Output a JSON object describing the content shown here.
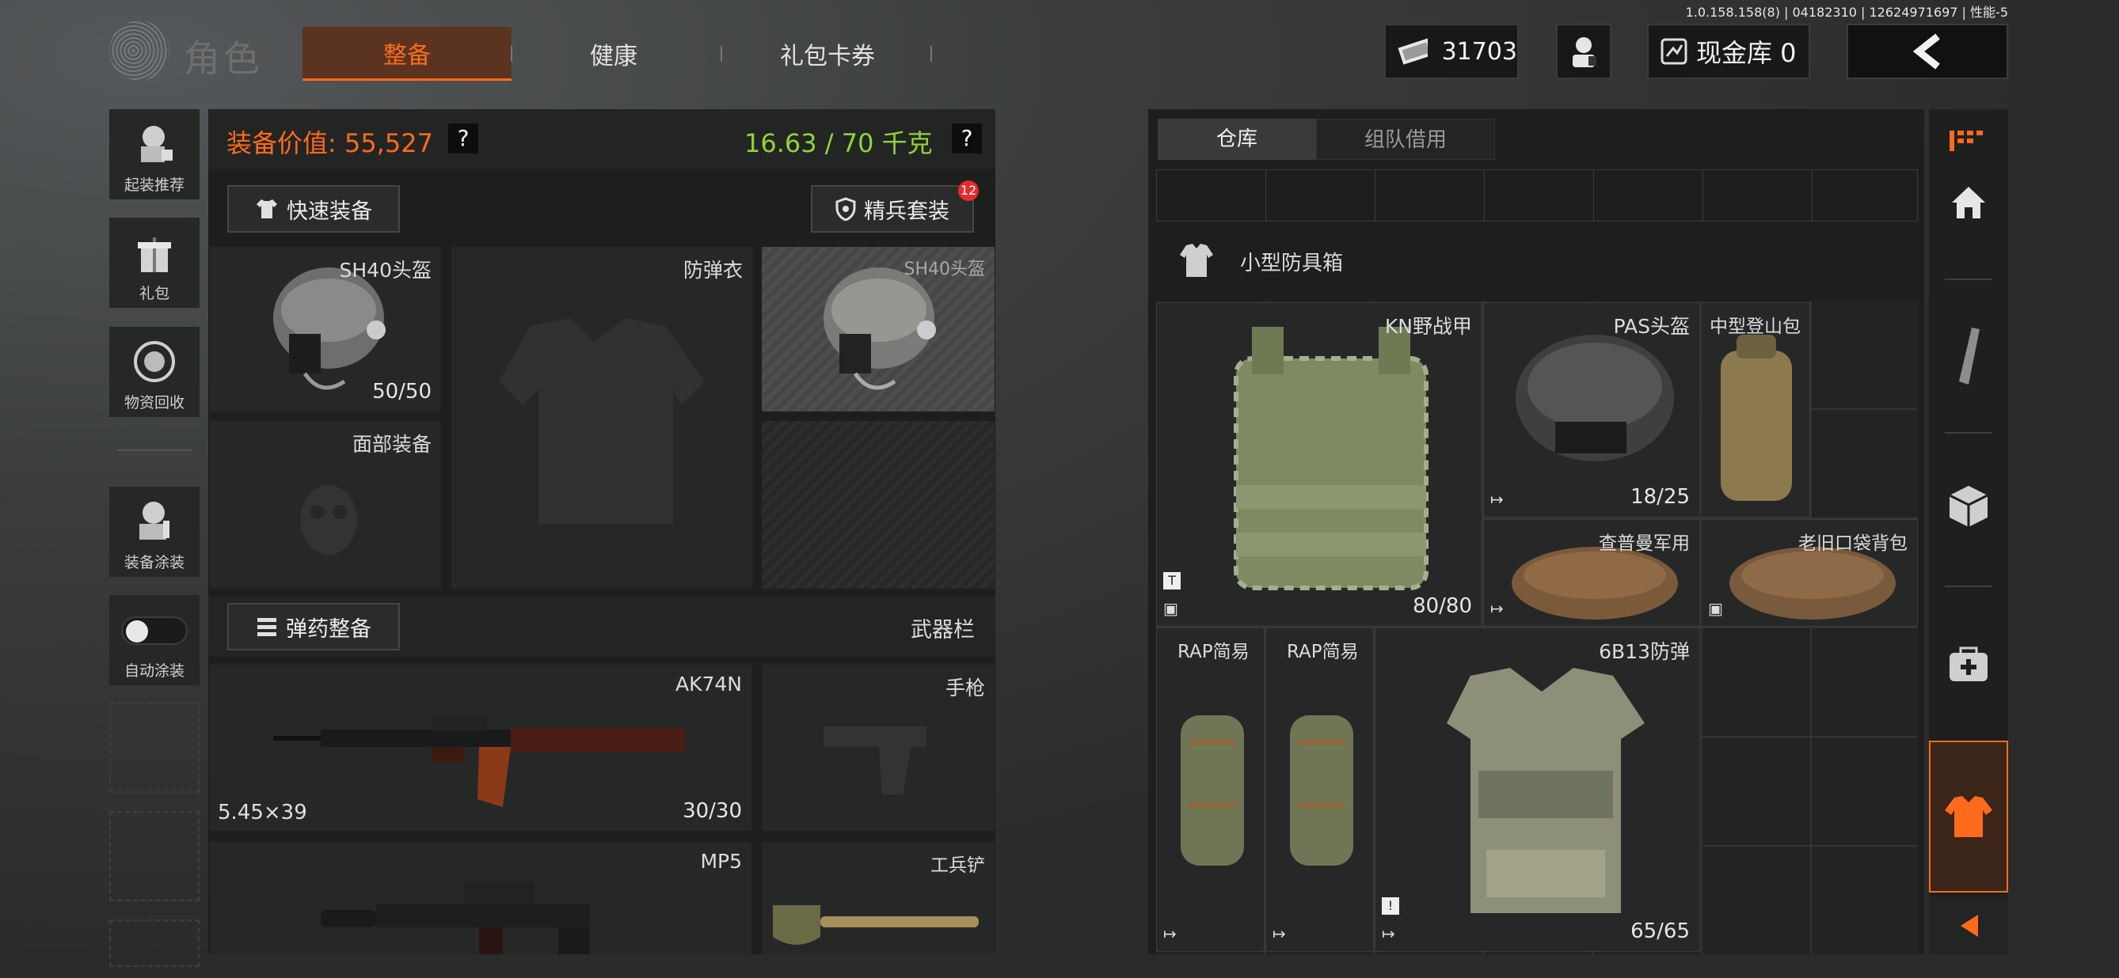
{
  "version": "1.0.158.158(8) | 04182310 | 12624971697 | 性能-5",
  "header": {
    "role": "角色",
    "tabs": [
      "整备",
      "健康",
      "礼包卡券"
    ],
    "money": "31703",
    "cash_store": "现金库 0"
  },
  "left": {
    "value_label": "装备价值: 55,527",
    "weight": "16.63 / 70 千克",
    "help": "?",
    "quick_equip": "快速装备",
    "elite_set": "精兵套装",
    "elite_badge": "12",
    "side": [
      "起装推荐",
      "礼包",
      "物资回收",
      "装备涂装",
      "自动涂装"
    ],
    "slots": {
      "helmet": {
        "name": "SH40头盔",
        "count": "50/50"
      },
      "armor": {
        "name": "防弹衣"
      },
      "helmet2": {
        "name": "SH40头盔"
      },
      "face": {
        "name": "面部装备"
      }
    },
    "ammo": "弹药整备",
    "weapon_bar": "武器栏",
    "weapons": [
      {
        "name": "AK74N",
        "caliber": "5.45×39",
        "count": "30/30"
      },
      {
        "name": "手枪"
      },
      {
        "name": "MP5"
      },
      {
        "name": "工兵铲"
      }
    ]
  },
  "right": {
    "tabs": [
      "仓库",
      "组队借用"
    ],
    "box_title": "小型防具箱",
    "items": [
      {
        "name": "KN野战甲",
        "count": "80/80"
      },
      {
        "name": "PAS头盔",
        "count": "18/25"
      },
      {
        "name": "中型登山包"
      },
      {
        "name": "查普曼军用"
      },
      {
        "name": "老旧口袋背包"
      },
      {
        "name": "RAP简易"
      },
      {
        "name": "RAP简易"
      },
      {
        "name": "6B13防弹",
        "count": "65/65"
      }
    ]
  },
  "colors": {
    "accent": "#ff6a1c",
    "weight_green": "#8fd43a",
    "value_orange": "#ff6a1c"
  }
}
